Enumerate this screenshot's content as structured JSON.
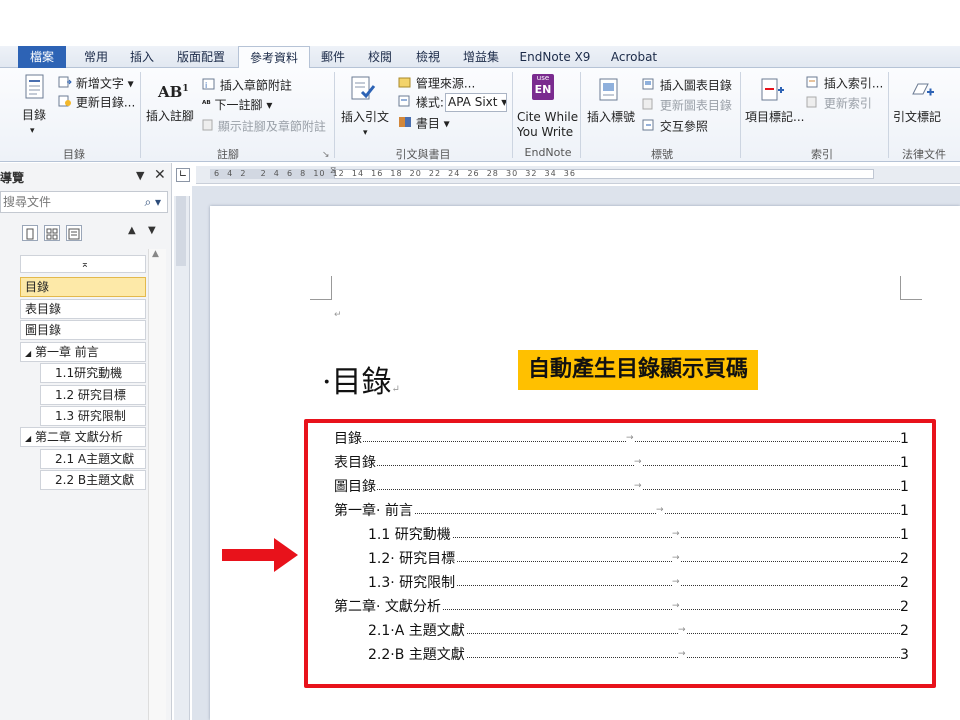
{
  "tabs": [
    "檔案",
    "常用",
    "插入",
    "版面配置",
    "參考資料",
    "郵件",
    "校閱",
    "檢視",
    "增益集",
    "EndNote X9",
    "Acrobat"
  ],
  "ribbon": {
    "toc_group": {
      "big_button": "目錄",
      "add_text": "新增文字",
      "update_toc": "更新目錄...",
      "label": "目錄"
    },
    "footnote_group": {
      "insert_footnote": "插入註腳",
      "insert_endnote": "插入章節附註",
      "next_footnote": "下一註腳",
      "show_notes": "顯示註腳及章節附註",
      "label": "註腳"
    },
    "citation_group": {
      "insert_citation": "插入引文",
      "manage_sources": "管理來源...",
      "style_label": "樣式:",
      "style_value": "APA Sixt",
      "bibliography": "書目",
      "label": "引文與書目"
    },
    "endnote_group": {
      "badge_top": "use",
      "badge_bottom": "EN",
      "cite_line1": "Cite While",
      "cite_line2": "You Write",
      "label": "EndNote"
    },
    "caption_group": {
      "insert_caption": "插入標號",
      "insert_table_of_figures": "插入圖表目錄",
      "update_table": "更新圖表目錄",
      "cross_reference": "交互參照",
      "label": "標號"
    },
    "index_group": {
      "mark_entry": "項目標記...",
      "insert_index": "插入索引...",
      "update_index": "更新索引",
      "label": "索引"
    },
    "authorities_group": {
      "mark_citation": "引文標記",
      "label": "法律文件"
    }
  },
  "nav": {
    "title": "導覽",
    "search_placeholder": "搜尋文件",
    "items": [
      "目錄",
      "表目錄",
      "圖目錄",
      "第一章 前言",
      "1.1研究動機",
      "1.2 研究目標",
      "1.3 研究限制",
      "第二章 文獻分析",
      "2.1 A主題文獻",
      "2.2 B主題文獻"
    ]
  },
  "ruler": {
    "marks": "6  4  2    2  4  6  8  10  12  14  16  18  20  22  24  26  28  30  32  34  36"
  },
  "document": {
    "title": "·目錄",
    "callout": "自動產生目錄顯示頁碼",
    "toc": [
      {
        "text": "目錄",
        "page": "1"
      },
      {
        "text": "表目錄",
        "page": "1"
      },
      {
        "text": "圖目錄",
        "page": "1"
      },
      {
        "text": "第一章· 前言",
        "page": "1"
      },
      {
        "text": "1.1 研究動機",
        "page": "1"
      },
      {
        "text": "1.2· 研究目標",
        "page": "2"
      },
      {
        "text": "1.3· 研究限制",
        "page": "2"
      },
      {
        "text": "第二章· 文獻分析",
        "page": "2"
      },
      {
        "text": "2.1·A 主題文獻",
        "page": "2"
      },
      {
        "text": "2.2·B 主題文獻",
        "page": "3"
      }
    ]
  },
  "colors": {
    "file_tab": "#2d63b5",
    "highlight_box": "#e8121b",
    "callout_bg": "#ffc000",
    "arrow": "#e8121b"
  }
}
